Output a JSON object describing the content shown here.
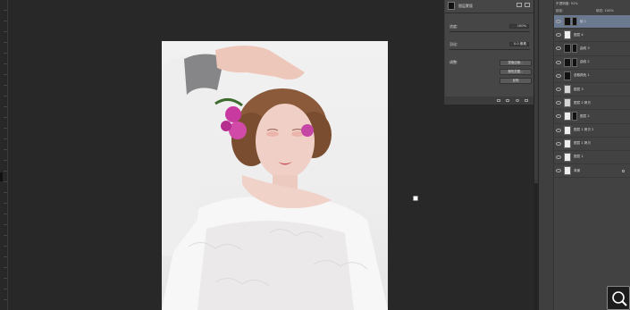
{
  "properties_panel": {
    "title": "图层蒙版",
    "density_label": "浓度:",
    "density_value": "100%",
    "feather_label": "羽化:",
    "feather_value": "0.0 像素",
    "refine_label": "调整:",
    "buttons": [
      "蒙版边缘...",
      "颜色范围...",
      "反相"
    ]
  },
  "layers_panel": {
    "header_top": "不透明度: 91%",
    "header_lock": "锁定:",
    "header_fill": "填充: 100%",
    "layers": [
      {
        "name": "组 1",
        "thumb": "folder",
        "mask": true,
        "selected": true
      },
      {
        "name": "图层 4",
        "thumb": "photo",
        "mask": false,
        "selected": false
      },
      {
        "name": "曲线 3",
        "thumb": "adjust",
        "mask": true,
        "selected": false
      },
      {
        "name": "曲线 2",
        "thumb": "adjust",
        "mask": true,
        "selected": false
      },
      {
        "name": "选取颜色 1",
        "thumb": "adjust",
        "mask": false,
        "selected": false
      },
      {
        "name": "图层 3",
        "thumb": "blank",
        "mask": false,
        "selected": false
      },
      {
        "name": "图层 2 拷贝",
        "thumb": "blank",
        "mask": false,
        "selected": false
      },
      {
        "name": "图层 2",
        "thumb": "photo",
        "mask": true,
        "selected": false
      },
      {
        "name": "图层 1 拷贝 2",
        "thumb": "photo",
        "mask": false,
        "selected": false
      },
      {
        "name": "图层 1 拷贝",
        "thumb": "photo",
        "mask": false,
        "selected": false
      },
      {
        "name": "图层 1",
        "thumb": "photo",
        "mask": false,
        "selected": false
      },
      {
        "name": "背景",
        "thumb": "photo",
        "mask": false,
        "selected": false,
        "locked": true
      }
    ]
  },
  "colors": {
    "workspace": "#282828",
    "panel": "#464646",
    "selection": "#6b7a90"
  }
}
